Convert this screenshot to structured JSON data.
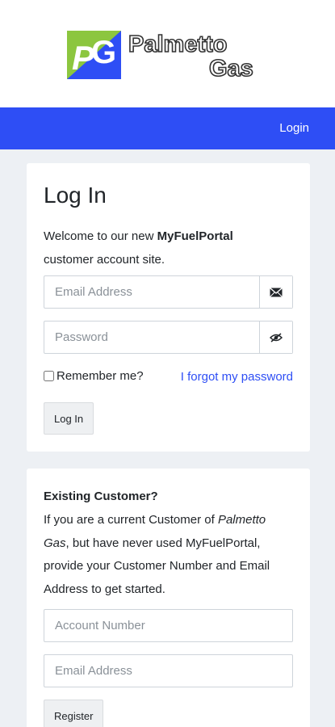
{
  "brand": {
    "logo_line1": "Palmetto",
    "logo_line2": "Gas",
    "mark_letters": "PG",
    "colors": {
      "green": "#8cc63f",
      "blue": "#2e4ef5"
    }
  },
  "navbar": {
    "login_link": "Login",
    "color": "#2e4ef5"
  },
  "login_card": {
    "title": "Log In",
    "welcome_prefix": "Welcome to our new ",
    "welcome_brand": "MyFuelPortal",
    "welcome_suffix": " customer account site.",
    "email_placeholder": "Email Address",
    "email_icon": "envelope-icon",
    "password_placeholder": "Password",
    "password_icon": "eye-slash-icon",
    "remember_label": "Remember me?",
    "remember_checked": false,
    "forgot_link": "I forgot my password",
    "submit_label": "Log In"
  },
  "register_card": {
    "heading": "Existing Customer?",
    "text_prefix": "If you are a current Customer of ",
    "text_company": "Palmetto Gas",
    "text_suffix": ", but have never used MyFuelPortal, provide your Customer Number and Email Address to get started.",
    "account_placeholder": "Account Number",
    "email_placeholder": "Email Address",
    "submit_label": "Register"
  }
}
